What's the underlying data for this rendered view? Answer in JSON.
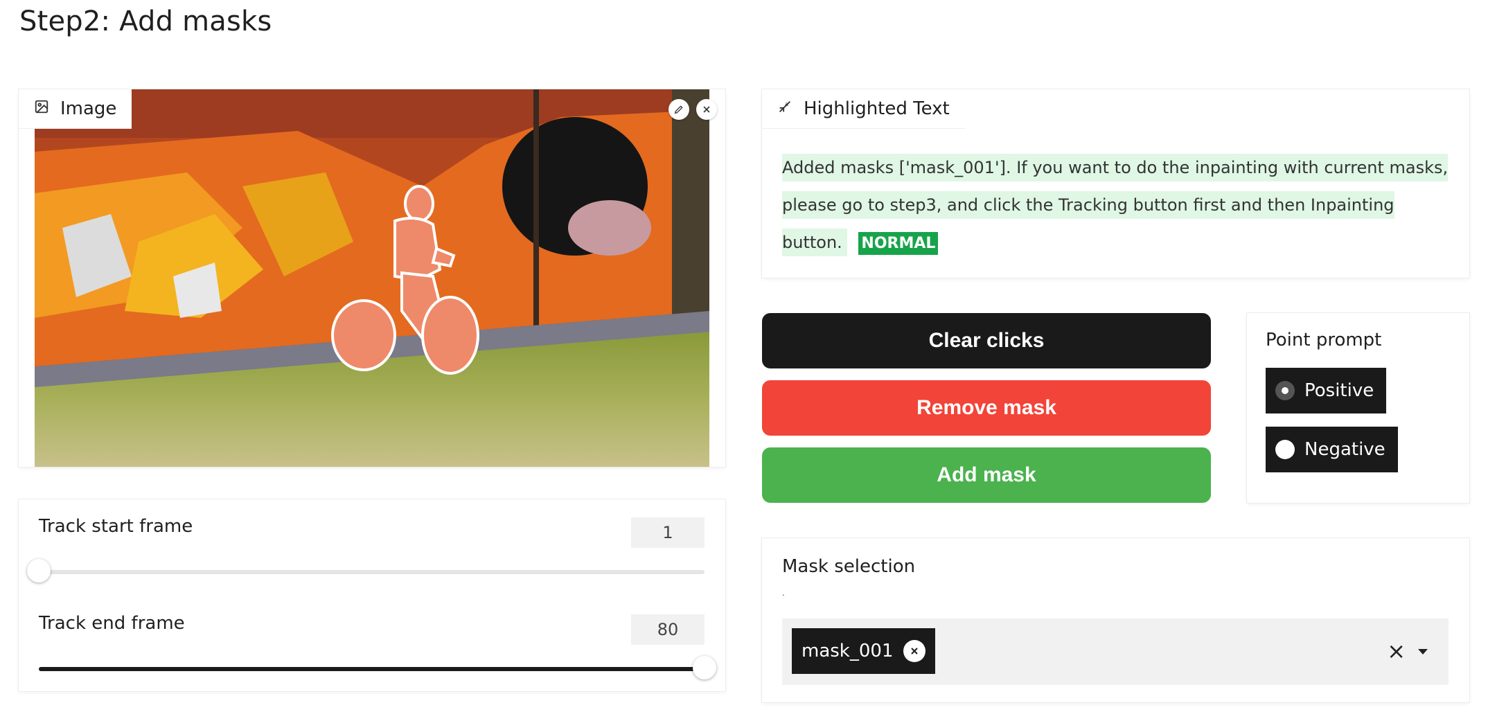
{
  "page": {
    "title": "Step2: Add masks"
  },
  "image_panel": {
    "label": "Image",
    "icon": "image-icon"
  },
  "highlighted_text": {
    "label": "Highlighted Text",
    "text": " Added masks ['mask_001']. If you want to do the inpainting with current masks, please go to step3, and click the Tracking button first and then Inpainting button. ",
    "tag": "NORMAL",
    "tag_color": "#17a34a",
    "highlight_color": "#dff7e4"
  },
  "buttons": {
    "clear": {
      "label": "Clear clicks",
      "color": "#1a1a1a"
    },
    "remove": {
      "label": "Remove mask",
      "color": "#f24438"
    },
    "add": {
      "label": "Add mask",
      "color": "#4bb24e"
    }
  },
  "point_prompt": {
    "title": "Point prompt",
    "options": [
      "Positive",
      "Negative"
    ],
    "selected": "Positive"
  },
  "mask_selection": {
    "title": "Mask selection",
    "subtitle": ".",
    "chips": [
      "mask_001"
    ]
  },
  "sliders": {
    "start": {
      "label": "Track start frame",
      "value": "1",
      "fraction": 0.0
    },
    "end": {
      "label": "Track end frame",
      "value": "80",
      "fraction": 1.0
    }
  }
}
